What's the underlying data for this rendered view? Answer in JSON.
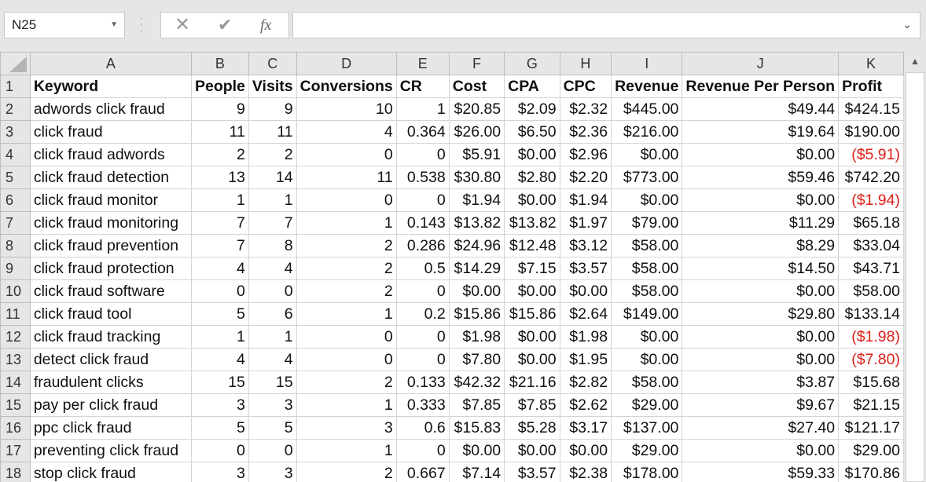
{
  "name_box": {
    "value": "N25"
  },
  "formula_bar": {
    "cancel": "✕",
    "enter": "✔",
    "fx": "fx",
    "value": ""
  },
  "columns": [
    "A",
    "B",
    "C",
    "D",
    "E",
    "F",
    "G",
    "H",
    "I",
    "J",
    "K"
  ],
  "header_row": {
    "row_number": "1",
    "cells": [
      "Keyword",
      "People",
      "Visits",
      "Conversions",
      "CR",
      "Cost",
      "CPA",
      "CPC",
      "Revenue",
      "Revenue Per Person",
      "Profit"
    ]
  },
  "rows": [
    {
      "n": "2",
      "cells": [
        "adwords click fraud",
        "9",
        "9",
        "10",
        "1",
        "$20.85",
        "$2.09",
        "$2.32",
        "$445.00",
        "$49.44",
        "$424.15"
      ]
    },
    {
      "n": "3",
      "cells": [
        "click fraud",
        "11",
        "11",
        "4",
        "0.364",
        "$26.00",
        "$6.50",
        "$2.36",
        "$216.00",
        "$19.64",
        "$190.00"
      ]
    },
    {
      "n": "4",
      "cells": [
        "click fraud adwords",
        "2",
        "2",
        "0",
        "0",
        "$5.91",
        "$0.00",
        "$2.96",
        "$0.00",
        "$0.00",
        "($5.91)"
      ]
    },
    {
      "n": "5",
      "cells": [
        "click fraud detection",
        "13",
        "14",
        "11",
        "0.538",
        "$30.80",
        "$2.80",
        "$2.20",
        "$773.00",
        "$59.46",
        "$742.20"
      ]
    },
    {
      "n": "6",
      "cells": [
        "click fraud monitor",
        "1",
        "1",
        "0",
        "0",
        "$1.94",
        "$0.00",
        "$1.94",
        "$0.00",
        "$0.00",
        "($1.94)"
      ]
    },
    {
      "n": "7",
      "cells": [
        "click fraud monitoring",
        "7",
        "7",
        "1",
        "0.143",
        "$13.82",
        "$13.82",
        "$1.97",
        "$79.00",
        "$11.29",
        "$65.18"
      ]
    },
    {
      "n": "8",
      "cells": [
        "click fraud prevention",
        "7",
        "8",
        "2",
        "0.286",
        "$24.96",
        "$12.48",
        "$3.12",
        "$58.00",
        "$8.29",
        "$33.04"
      ]
    },
    {
      "n": "9",
      "cells": [
        "click fraud protection",
        "4",
        "4",
        "2",
        "0.5",
        "$14.29",
        "$7.15",
        "$3.57",
        "$58.00",
        "$14.50",
        "$43.71"
      ]
    },
    {
      "n": "10",
      "cells": [
        "click fraud software",
        "0",
        "0",
        "2",
        "0",
        "$0.00",
        "$0.00",
        "$0.00",
        "$58.00",
        "$0.00",
        "$58.00"
      ]
    },
    {
      "n": "11",
      "cells": [
        "click fraud tool",
        "5",
        "6",
        "1",
        "0.2",
        "$15.86",
        "$15.86",
        "$2.64",
        "$149.00",
        "$29.80",
        "$133.14"
      ]
    },
    {
      "n": "12",
      "cells": [
        "click fraud tracking",
        "1",
        "1",
        "0",
        "0",
        "$1.98",
        "$0.00",
        "$1.98",
        "$0.00",
        "$0.00",
        "($1.98)"
      ]
    },
    {
      "n": "13",
      "cells": [
        "detect click fraud",
        "4",
        "4",
        "0",
        "0",
        "$7.80",
        "$0.00",
        "$1.95",
        "$0.00",
        "$0.00",
        "($7.80)"
      ]
    },
    {
      "n": "14",
      "cells": [
        "fraudulent clicks",
        "15",
        "15",
        "2",
        "0.133",
        "$42.32",
        "$21.16",
        "$2.82",
        "$58.00",
        "$3.87",
        "$15.68"
      ]
    },
    {
      "n": "15",
      "cells": [
        "pay per click fraud",
        "3",
        "3",
        "1",
        "0.333",
        "$7.85",
        "$7.85",
        "$2.62",
        "$29.00",
        "$9.67",
        "$21.15"
      ]
    },
    {
      "n": "16",
      "cells": [
        "ppc click fraud",
        "5",
        "5",
        "3",
        "0.6",
        "$15.83",
        "$5.28",
        "$3.17",
        "$137.00",
        "$27.40",
        "$121.17"
      ]
    },
    {
      "n": "17",
      "cells": [
        "preventing click fraud",
        "0",
        "0",
        "1",
        "0",
        "$0.00",
        "$0.00",
        "$0.00",
        "$29.00",
        "$0.00",
        "$29.00"
      ]
    },
    {
      "n": "18",
      "cells": [
        "stop click fraud",
        "3",
        "3",
        "2",
        "0.667",
        "$7.14",
        "$3.57",
        "$2.38",
        "$178.00",
        "$59.33",
        "$170.86"
      ]
    }
  ],
  "colors": {
    "negative": "#e0201a",
    "header_bg": "#e6e6e6",
    "gridline": "#d4d4d4"
  }
}
